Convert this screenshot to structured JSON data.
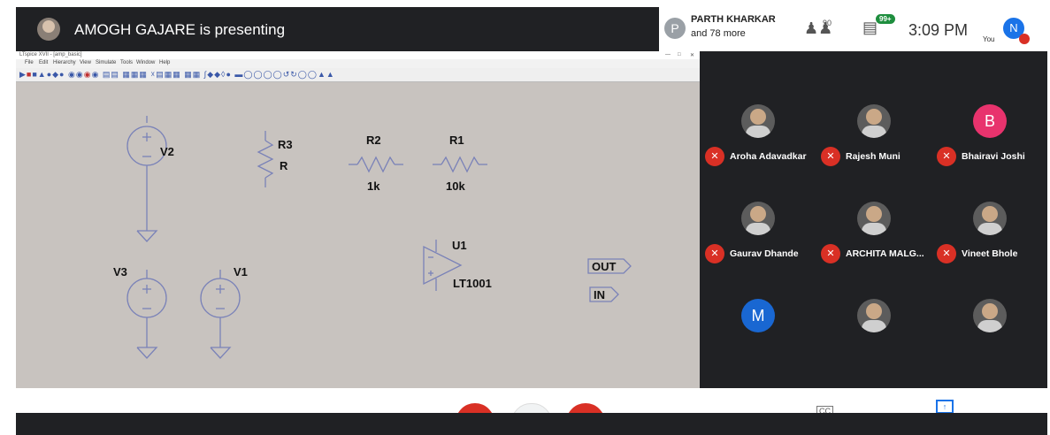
{
  "meet": {
    "presenter_text": "AMOGH GAJARE is presenting",
    "participants_header": {
      "avatar_letter": "P",
      "name": "PARTH KHARKAR",
      "more": "and 78 more"
    },
    "people_count": "90",
    "chat_badge": "99+",
    "time": "3:09 PM",
    "you_label": "You",
    "you_avatar_letter": "N",
    "participants": [
      {
        "name": "Aroha Adavadkar",
        "avatar": "photo"
      },
      {
        "name": "Rajesh Muni",
        "avatar": "photo"
      },
      {
        "name": "Bhairavi Joshi",
        "avatar": "B",
        "color": "#e8336d"
      },
      {
        "name": "Gaurav Dhande",
        "avatar": "photo"
      },
      {
        "name": "ARCHITA MALG...",
        "avatar": "photo"
      },
      {
        "name": "Vineet Bhole",
        "avatar": "photo"
      },
      {
        "name": "",
        "avatar": "M",
        "color": "#1967d2"
      },
      {
        "name": "",
        "avatar": "photo"
      },
      {
        "name": "",
        "avatar": "photo"
      }
    ],
    "accent_red": "#d93025",
    "accent_blue": "#1a73e8"
  },
  "ltspice": {
    "title": "LTspice XVII - [amp_basic]",
    "menu": [
      "File",
      "Edit",
      "Hierarchy",
      "View",
      "Simulate",
      "Tools",
      "Window",
      "Help"
    ],
    "components": {
      "V2": "V2",
      "V3": "V3",
      "V1": "V1",
      "R3": "R3",
      "R3_value": "R",
      "R2": "R2",
      "R2_value": "1k",
      "R1": "R1",
      "R1_value": "10k",
      "U1": "U1",
      "U1_value": "LT1001",
      "out_label": "OUT",
      "in_label": "IN"
    }
  }
}
